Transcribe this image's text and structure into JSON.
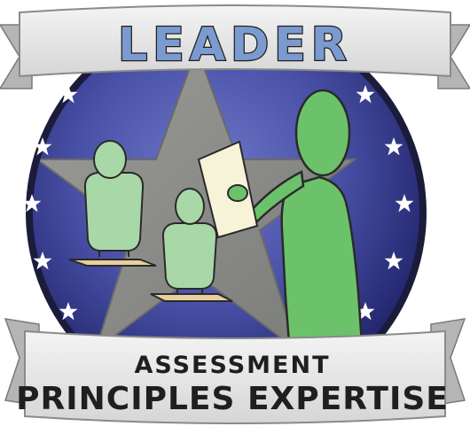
{
  "badge": {
    "title": "LEADER",
    "subtitle_line1": "ASSESSMENT",
    "subtitle_line2": "PRINCIPLES EXPERTISE"
  },
  "colors": {
    "circle_dark": "#2a2d78",
    "circle_mid": "#4a52a8",
    "circle_light": "#6e78c8",
    "star_gray": "#8b8c8a",
    "ribbon": "#e4e4e4",
    "ribbon_shadow": "#b3b3b3",
    "title_fill": "#7b9bd0",
    "text_dark": "#1f1f1f",
    "leader_green": "#6cc26a",
    "student_green": "#a9d8a8",
    "desk": "#e7cfa0",
    "paper": "#f7f3d8"
  },
  "icons": [
    "white-star-icon",
    "large-gray-star-icon",
    "leader-figure-icon",
    "student-figure-icon"
  ]
}
